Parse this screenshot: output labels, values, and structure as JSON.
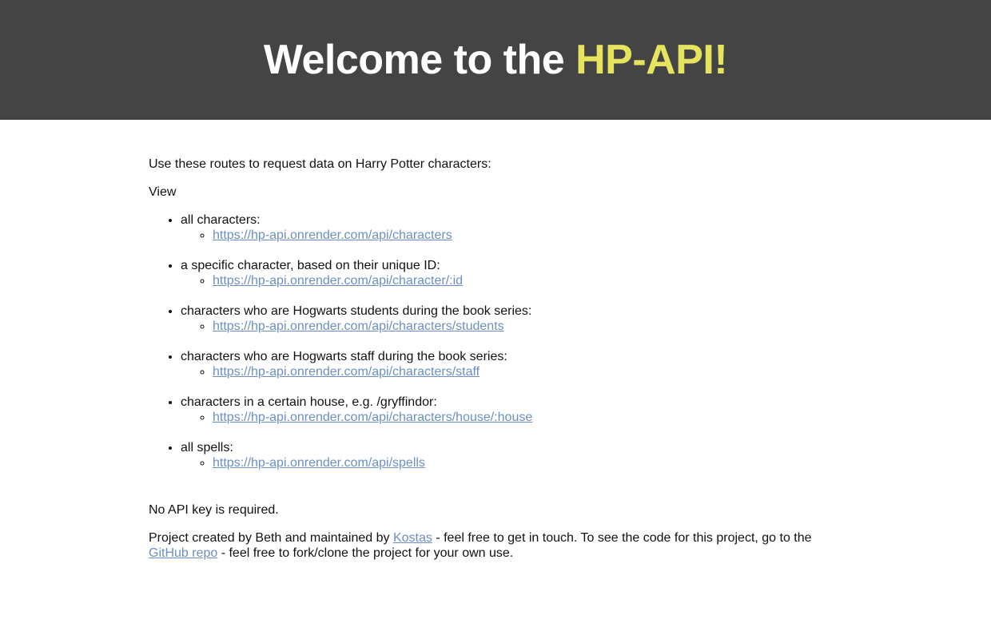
{
  "header": {
    "title_prefix": "Welcome to the ",
    "title_accent": "HP-API!",
    "accent_color": "#e6e35e",
    "background_color": "#444444"
  },
  "main": {
    "intro": "Use these routes to request data on Harry Potter characters:",
    "view_label": "View",
    "routes": [
      {
        "label": "all characters:",
        "url": "https://hp-api.onrender.com/api/characters"
      },
      {
        "label": "a specific character, based on their unique ID:",
        "url": "https://hp-api.onrender.com/api/character/:id"
      },
      {
        "label": "characters who are Hogwarts students during the book series:",
        "url": "https://hp-api.onrender.com/api/characters/students"
      },
      {
        "label": "characters who are Hogwarts staff during the book series:",
        "url": "https://hp-api.onrender.com/api/characters/staff"
      },
      {
        "label": "characters in a certain house, e.g. /gryffindor:",
        "url": "https://hp-api.onrender.com/api/characters/house/:house"
      },
      {
        "label": "all spells:",
        "url": "https://hp-api.onrender.com/api/spells"
      }
    ],
    "note": "No API key is required.",
    "credits": {
      "part1": "Project created by Beth and maintained by ",
      "author_link": "Kostas",
      "part2": " - feel free to get in touch. To see the code for this project, go to the ",
      "repo_link": "GitHub repo",
      "part3": " - feel free to fork/clone the project for your own use."
    },
    "link_color": "#6b8fc4"
  }
}
